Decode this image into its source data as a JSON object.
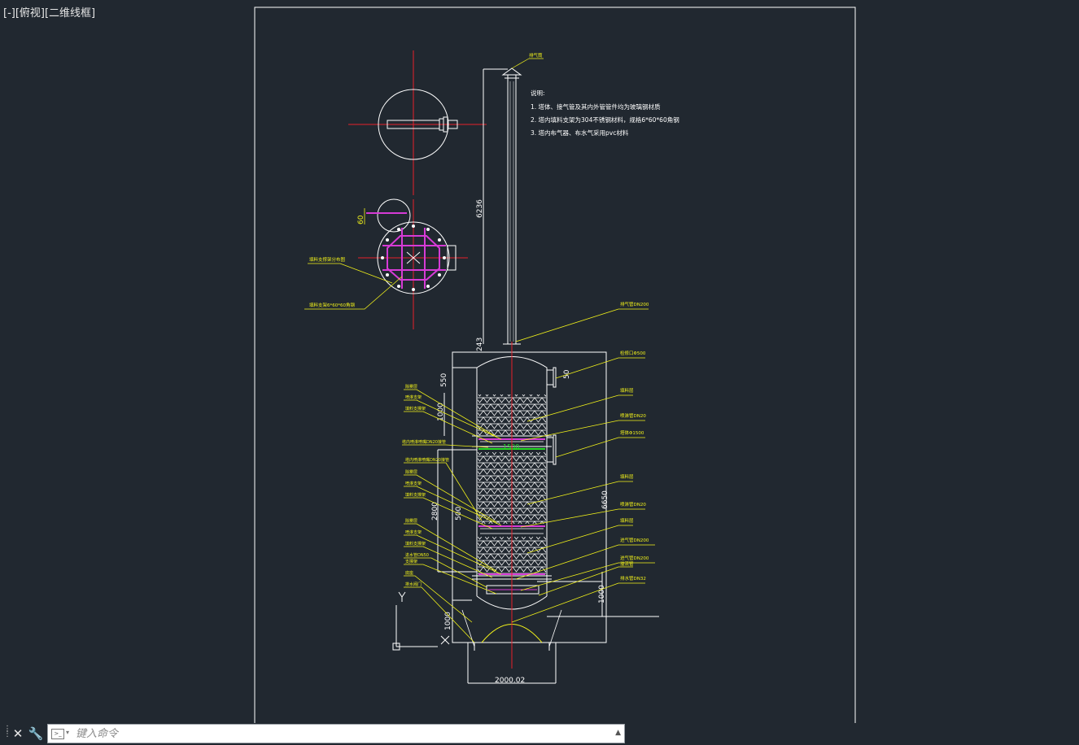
{
  "viewport": {
    "label": "[-][俯视][二维线框]"
  },
  "drawing": {
    "notes": {
      "heading": "说明:",
      "items": [
        "1. 塔体、接气管及其内外管管件均为玻璃钢材质",
        "2. 塔内填料支架为304不锈钢材料，规格6*60*60角钢",
        "3. 塔内布气器、布水气采用pvc材料"
      ]
    },
    "dimensions": {
      "stack_height": "6236",
      "stack_base": "243",
      "top_head": "550",
      "top_inlet": "50",
      "upper_packing": "1000",
      "lower_section": "2800",
      "middle_packing": "500",
      "total_height": "6650",
      "skirt": "1000",
      "bottom": "1000",
      "base_width": "2000.02",
      "shell_dia": "1500",
      "plan_offset": "60"
    },
    "callouts_right": [
      "排气筒",
      "排气管DN200",
      "检修口Φ500",
      "填料层",
      "喷淋管DN20",
      "塔体Φ1500",
      "填料层",
      "喷淋管DN20",
      "填料层",
      "进气管DN200",
      "进气管DN200",
      "溢流管",
      "排水管DN32"
    ],
    "callouts_left": [
      "除雾层",
      "喷淋支架",
      "填料支撑架",
      "塔内喷淋喷嘴DN20接管",
      "塔内喷淋喷嘴DN20接管",
      "除雾层",
      "喷淋支架",
      "填料支撑架",
      "除雾层",
      "喷淋支架",
      "填料支撑架",
      "进水管DN50",
      "支撑架",
      "底座",
      "排水阀门"
    ],
    "plan_callouts": [
      "填料支撑架分布图",
      "填料支架6*60*60角钢"
    ]
  },
  "command_line": {
    "placeholder": "键入命令",
    "close_symbol": "✕",
    "tools_symbol": "🔧"
  },
  "colors": {
    "background": "#212830",
    "lines": "#ffffff",
    "centerline": "#e8202a",
    "annotation": "#f2f21a",
    "magenta": "#d63bd6",
    "green": "#26d926"
  }
}
